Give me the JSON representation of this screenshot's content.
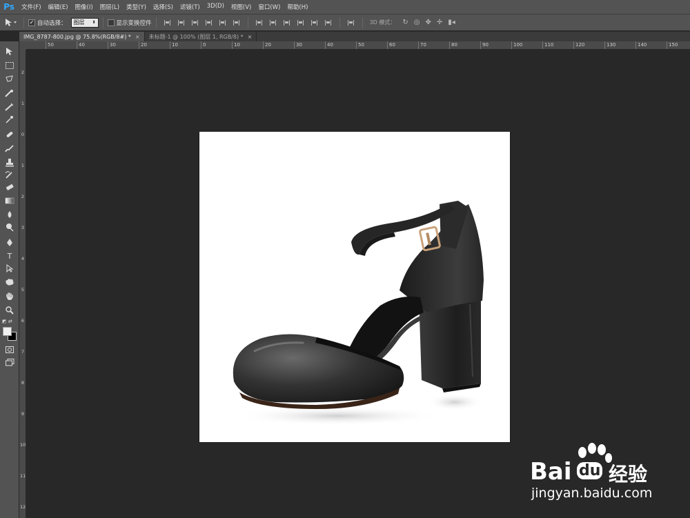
{
  "app": {
    "logo": "Ps"
  },
  "menu": [
    "文件(F)",
    "编辑(E)",
    "图像(I)",
    "图层(L)",
    "类型(Y)",
    "选择(S)",
    "滤镜(T)",
    "3D(D)",
    "视图(V)",
    "窗口(W)",
    "帮助(H)"
  ],
  "options": {
    "auto_select_label": "自动选择：",
    "auto_select_checked": "✓",
    "auto_select_target": "图层",
    "show_transform_label": "显示变换控件",
    "mode_3d_label": "3D 模式："
  },
  "tabs": [
    {
      "label": "IMG_8787-800.jpg @ 75.8%(RGB/8#) *",
      "close": "×"
    },
    {
      "label": "未标题-1 @ 100% (图层 1, RGB/8) *",
      "close": "×"
    }
  ],
  "ruler_h": [
    "50",
    "40",
    "30",
    "20",
    "10",
    "0",
    "10",
    "20",
    "30",
    "40",
    "50",
    "60",
    "70",
    "80",
    "90",
    "100",
    "110",
    "120",
    "130",
    "140",
    "150"
  ],
  "ruler_v": [
    "2",
    "1",
    "0",
    "1",
    "2",
    "3",
    "4",
    "5",
    "6",
    "7",
    "8",
    "9",
    "10",
    "11",
    "12"
  ],
  "watermark": {
    "brand_bai": "Bai",
    "brand_du": "du",
    "brand_cn": "经验",
    "url": "jingyan.baidu.com"
  },
  "colors": {
    "foreground": "#f0f0f0",
    "background": "#000000",
    "workspace": "#282828",
    "panel": "#535353"
  }
}
